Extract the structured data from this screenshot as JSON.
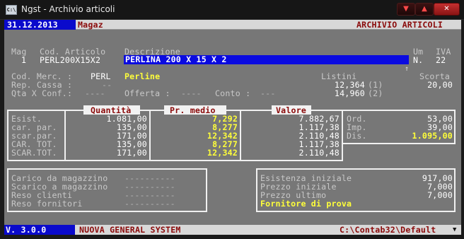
{
  "window": {
    "title": "Ngst - Archivio articoli",
    "icon": "C:\\"
  },
  "header": {
    "date": "31.12.2013",
    "company": "Magaz",
    "module": "ARCHIVIO ARTICOLI"
  },
  "article": {
    "labels": {
      "mag": "Mag",
      "code": "Cod. Articolo",
      "desc": "Descrizione",
      "um": "Um",
      "iva": "IVA"
    },
    "mag": "1",
    "code": "PERL200X15X2",
    "description": "PERLINA 200 X 15 X 2",
    "um": "N.",
    "iva": "22",
    "cursor": "↑"
  },
  "details": {
    "cod_merc_label": "Cod. Merc. :",
    "cod_merc": "PERL",
    "cod_merc_desc": "Perline",
    "rep_cassa_label": "Rep. Cassa :",
    "rep_cassa": "--",
    "qta_conf_label": "Qta X Conf.:",
    "qta_conf": "----",
    "offerta_label": "Offerta :",
    "offerta": "----",
    "conto_label": "Conto :",
    "conto": "---",
    "listini_label": "Listini",
    "listino1": "12,364",
    "listino1_idx": "(1)",
    "listino2": "14,960",
    "listino2_idx": "(2)",
    "scorta_label": "Scorta",
    "scorta": "20,00"
  },
  "movements": {
    "row_labels": [
      "Esist.",
      "car. par.",
      "scar.par.",
      "CAR. TOT.",
      "SCAR.TOT."
    ],
    "quantita_title": "Quantità",
    "quantita": [
      "1.081,00",
      "135,00",
      "171,00",
      "135,00",
      "171,00"
    ],
    "medio_title": "Pr. medio",
    "medio": [
      "7,292",
      "8,277",
      "12,342",
      "8,277",
      "12,342"
    ],
    "valore_title": "Valore",
    "valore": [
      "7.882,67",
      "1.117,38",
      "2.110,48",
      "1.117,38",
      "2.110,48"
    ]
  },
  "orders": {
    "labels": [
      "Ord.",
      "Imp.",
      "Dis."
    ],
    "values": [
      "53,00",
      "39,00",
      "1.095,00"
    ]
  },
  "causali": {
    "labels": [
      "Carico da magazzino",
      "Scarico a magazzino",
      "Reso clienti",
      "Reso fornitori"
    ],
    "values": [
      "----------",
      "----------",
      "----------",
      "----------"
    ]
  },
  "prezzi": {
    "esistenza_label": "Esistenza iniziale",
    "esistenza": "917,00",
    "iniziale_label": "Prezzo iniziale",
    "iniziale": "7,000",
    "ultimo_label": "Prezzo ultimo",
    "ultimo": "7,000",
    "fornitore": "Fornitore di prova"
  },
  "footer": {
    "version": "V. 3.0.0",
    "system": "NUOVA GENERAL SYSTEM",
    "path": "C:\\Contab32\\Default",
    "arrow": "▼"
  }
}
